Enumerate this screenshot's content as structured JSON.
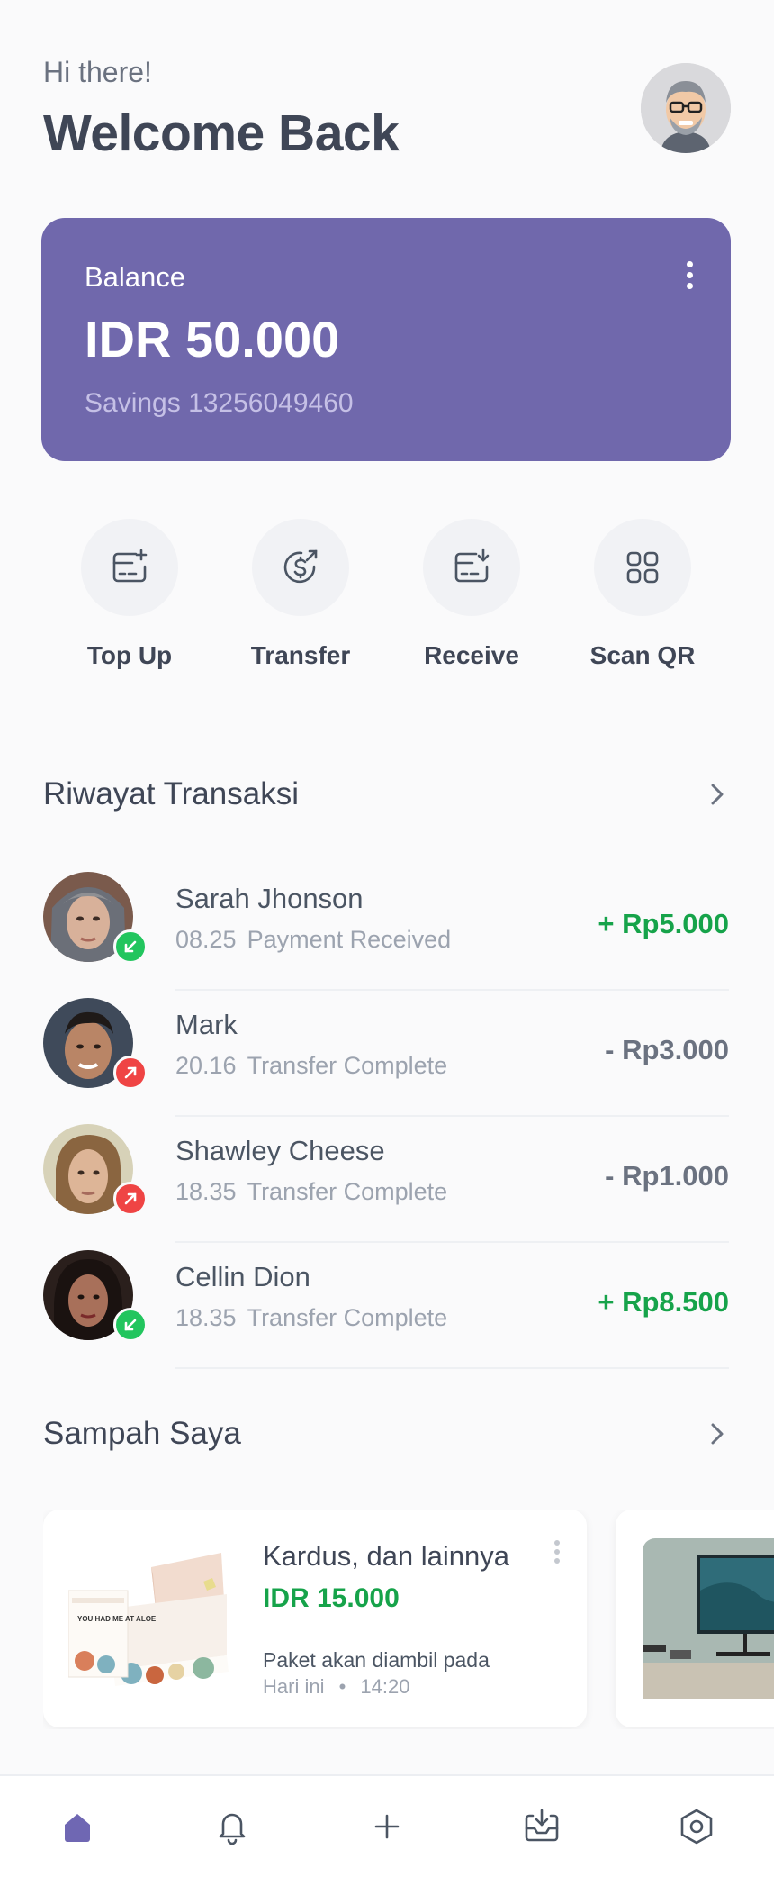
{
  "header": {
    "greeting": "Hi there!",
    "title": "Welcome Back"
  },
  "balance": {
    "label": "Balance",
    "amount": "IDR 50.000",
    "account": "Savings 13256049460"
  },
  "actions": [
    {
      "label": "Top Up",
      "icon": "top-up-icon"
    },
    {
      "label": "Transfer",
      "icon": "transfer-icon"
    },
    {
      "label": "Receive",
      "icon": "receive-icon"
    },
    {
      "label": "Scan QR",
      "icon": "scan-qr-icon"
    }
  ],
  "transactions": {
    "title": "Riwayat Transaksi",
    "items": [
      {
        "name": "Sarah Jhonson",
        "time": "08.25",
        "status": "Payment Received",
        "amount": "+ Rp5.000",
        "direction": "in"
      },
      {
        "name": "Mark",
        "time": "20.16",
        "status": "Transfer Complete",
        "amount": "- Rp3.000",
        "direction": "out"
      },
      {
        "name": "Shawley Cheese",
        "time": "18.35",
        "status": "Transfer Complete",
        "amount": "- Rp1.000",
        "direction": "out"
      },
      {
        "name": "Cellin Dion",
        "time": "18.35",
        "status": "Transfer Complete",
        "amount": "+ Rp8.500",
        "direction": "in"
      }
    ]
  },
  "sampah": {
    "title": "Sampah Saya",
    "card": {
      "title": "Kardus, dan lainnya",
      "price": "IDR 15.000",
      "note": "Paket akan diambil pada",
      "day": "Hari ini",
      "separator": "•",
      "time": "14:20",
      "box_text": "YOU HAD ME AT ALOE"
    }
  },
  "nav": [
    "home-icon",
    "bell-icon",
    "plus-icon",
    "inbox-download-icon",
    "settings-hexagon-icon"
  ],
  "colors": {
    "brand": "#7068ac",
    "positive": "#16a34a",
    "negative": "#ef4444",
    "badge_in": "#22c55e"
  }
}
